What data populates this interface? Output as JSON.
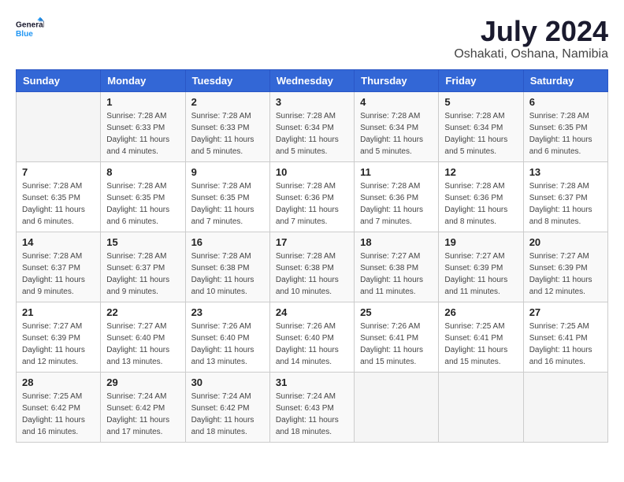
{
  "header": {
    "logo_general": "General",
    "logo_blue": "Blue",
    "month_year": "July 2024",
    "location": "Oshakati, Oshana, Namibia"
  },
  "days_of_week": [
    "Sunday",
    "Monday",
    "Tuesday",
    "Wednesday",
    "Thursday",
    "Friday",
    "Saturday"
  ],
  "weeks": [
    [
      {
        "day": "",
        "sunrise": "",
        "sunset": "",
        "daylight": ""
      },
      {
        "day": "1",
        "sunrise": "Sunrise: 7:28 AM",
        "sunset": "Sunset: 6:33 PM",
        "daylight": "Daylight: 11 hours and 4 minutes."
      },
      {
        "day": "2",
        "sunrise": "Sunrise: 7:28 AM",
        "sunset": "Sunset: 6:33 PM",
        "daylight": "Daylight: 11 hours and 5 minutes."
      },
      {
        "day": "3",
        "sunrise": "Sunrise: 7:28 AM",
        "sunset": "Sunset: 6:34 PM",
        "daylight": "Daylight: 11 hours and 5 minutes."
      },
      {
        "day": "4",
        "sunrise": "Sunrise: 7:28 AM",
        "sunset": "Sunset: 6:34 PM",
        "daylight": "Daylight: 11 hours and 5 minutes."
      },
      {
        "day": "5",
        "sunrise": "Sunrise: 7:28 AM",
        "sunset": "Sunset: 6:34 PM",
        "daylight": "Daylight: 11 hours and 5 minutes."
      },
      {
        "day": "6",
        "sunrise": "Sunrise: 7:28 AM",
        "sunset": "Sunset: 6:35 PM",
        "daylight": "Daylight: 11 hours and 6 minutes."
      }
    ],
    [
      {
        "day": "7",
        "sunrise": "Sunrise: 7:28 AM",
        "sunset": "Sunset: 6:35 PM",
        "daylight": "Daylight: 11 hours and 6 minutes."
      },
      {
        "day": "8",
        "sunrise": "Sunrise: 7:28 AM",
        "sunset": "Sunset: 6:35 PM",
        "daylight": "Daylight: 11 hours and 6 minutes."
      },
      {
        "day": "9",
        "sunrise": "Sunrise: 7:28 AM",
        "sunset": "Sunset: 6:35 PM",
        "daylight": "Daylight: 11 hours and 7 minutes."
      },
      {
        "day": "10",
        "sunrise": "Sunrise: 7:28 AM",
        "sunset": "Sunset: 6:36 PM",
        "daylight": "Daylight: 11 hours and 7 minutes."
      },
      {
        "day": "11",
        "sunrise": "Sunrise: 7:28 AM",
        "sunset": "Sunset: 6:36 PM",
        "daylight": "Daylight: 11 hours and 7 minutes."
      },
      {
        "day": "12",
        "sunrise": "Sunrise: 7:28 AM",
        "sunset": "Sunset: 6:36 PM",
        "daylight": "Daylight: 11 hours and 8 minutes."
      },
      {
        "day": "13",
        "sunrise": "Sunrise: 7:28 AM",
        "sunset": "Sunset: 6:37 PM",
        "daylight": "Daylight: 11 hours and 8 minutes."
      }
    ],
    [
      {
        "day": "14",
        "sunrise": "Sunrise: 7:28 AM",
        "sunset": "Sunset: 6:37 PM",
        "daylight": "Daylight: 11 hours and 9 minutes."
      },
      {
        "day": "15",
        "sunrise": "Sunrise: 7:28 AM",
        "sunset": "Sunset: 6:37 PM",
        "daylight": "Daylight: 11 hours and 9 minutes."
      },
      {
        "day": "16",
        "sunrise": "Sunrise: 7:28 AM",
        "sunset": "Sunset: 6:38 PM",
        "daylight": "Daylight: 11 hours and 10 minutes."
      },
      {
        "day": "17",
        "sunrise": "Sunrise: 7:28 AM",
        "sunset": "Sunset: 6:38 PM",
        "daylight": "Daylight: 11 hours and 10 minutes."
      },
      {
        "day": "18",
        "sunrise": "Sunrise: 7:27 AM",
        "sunset": "Sunset: 6:38 PM",
        "daylight": "Daylight: 11 hours and 11 minutes."
      },
      {
        "day": "19",
        "sunrise": "Sunrise: 7:27 AM",
        "sunset": "Sunset: 6:39 PM",
        "daylight": "Daylight: 11 hours and 11 minutes."
      },
      {
        "day": "20",
        "sunrise": "Sunrise: 7:27 AM",
        "sunset": "Sunset: 6:39 PM",
        "daylight": "Daylight: 11 hours and 12 minutes."
      }
    ],
    [
      {
        "day": "21",
        "sunrise": "Sunrise: 7:27 AM",
        "sunset": "Sunset: 6:39 PM",
        "daylight": "Daylight: 11 hours and 12 minutes."
      },
      {
        "day": "22",
        "sunrise": "Sunrise: 7:27 AM",
        "sunset": "Sunset: 6:40 PM",
        "daylight": "Daylight: 11 hours and 13 minutes."
      },
      {
        "day": "23",
        "sunrise": "Sunrise: 7:26 AM",
        "sunset": "Sunset: 6:40 PM",
        "daylight": "Daylight: 11 hours and 13 minutes."
      },
      {
        "day": "24",
        "sunrise": "Sunrise: 7:26 AM",
        "sunset": "Sunset: 6:40 PM",
        "daylight": "Daylight: 11 hours and 14 minutes."
      },
      {
        "day": "25",
        "sunrise": "Sunrise: 7:26 AM",
        "sunset": "Sunset: 6:41 PM",
        "daylight": "Daylight: 11 hours and 15 minutes."
      },
      {
        "day": "26",
        "sunrise": "Sunrise: 7:25 AM",
        "sunset": "Sunset: 6:41 PM",
        "daylight": "Daylight: 11 hours and 15 minutes."
      },
      {
        "day": "27",
        "sunrise": "Sunrise: 7:25 AM",
        "sunset": "Sunset: 6:41 PM",
        "daylight": "Daylight: 11 hours and 16 minutes."
      }
    ],
    [
      {
        "day": "28",
        "sunrise": "Sunrise: 7:25 AM",
        "sunset": "Sunset: 6:42 PM",
        "daylight": "Daylight: 11 hours and 16 minutes."
      },
      {
        "day": "29",
        "sunrise": "Sunrise: 7:24 AM",
        "sunset": "Sunset: 6:42 PM",
        "daylight": "Daylight: 11 hours and 17 minutes."
      },
      {
        "day": "30",
        "sunrise": "Sunrise: 7:24 AM",
        "sunset": "Sunset: 6:42 PM",
        "daylight": "Daylight: 11 hours and 18 minutes."
      },
      {
        "day": "31",
        "sunrise": "Sunrise: 7:24 AM",
        "sunset": "Sunset: 6:43 PM",
        "daylight": "Daylight: 11 hours and 18 minutes."
      },
      {
        "day": "",
        "sunrise": "",
        "sunset": "",
        "daylight": ""
      },
      {
        "day": "",
        "sunrise": "",
        "sunset": "",
        "daylight": ""
      },
      {
        "day": "",
        "sunrise": "",
        "sunset": "",
        "daylight": ""
      }
    ]
  ]
}
